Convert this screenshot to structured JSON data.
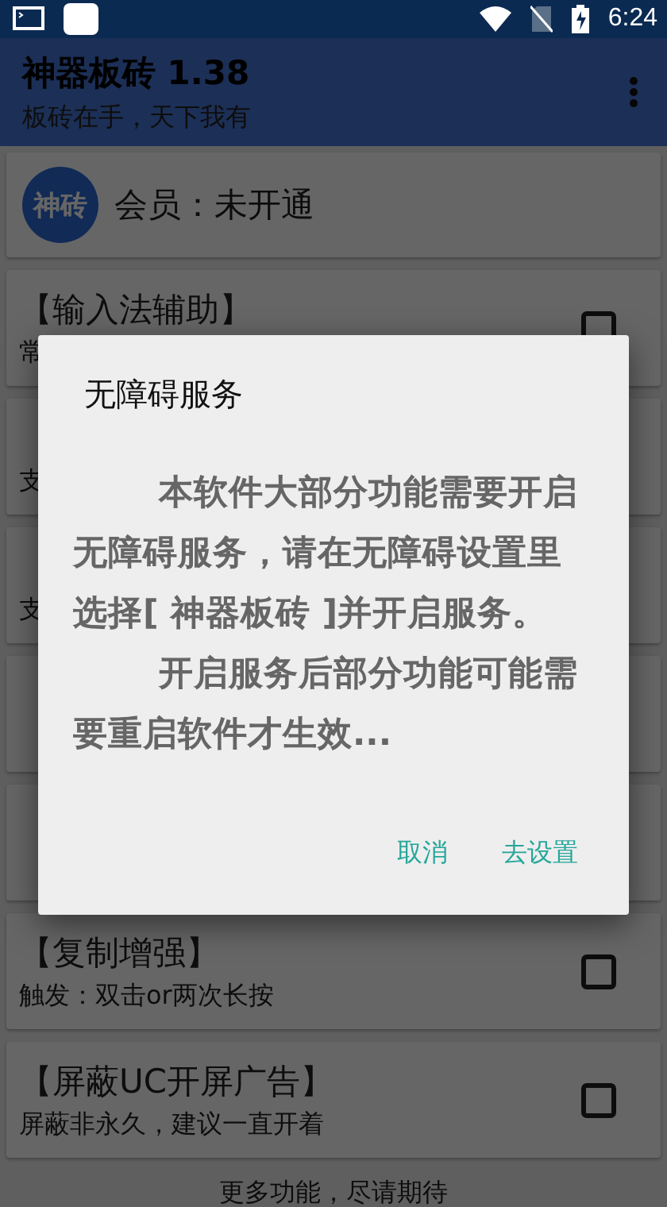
{
  "status_bar": {
    "time": "6:24"
  },
  "app_bar": {
    "title": "神器板砖  1.38",
    "subtitle": "板砖在手，天下我有"
  },
  "member": {
    "avatar_text": "神砖",
    "label": "会员：未开通"
  },
  "features": [
    {
      "kind": "feature",
      "title": "【输入法辅助】",
      "subtitle": "常",
      "checked": false
    },
    {
      "kind": "feature",
      "subtitle": "支"
    },
    {
      "kind": "feature",
      "subtitle": "支"
    },
    {
      "kind": "covered"
    },
    {
      "kind": "covered"
    },
    {
      "kind": "feature",
      "title": "【复制增强】",
      "subtitle": "触发：双击or两次长按",
      "checked": false
    },
    {
      "kind": "feature",
      "title": "【屏蔽UC开屏广告】",
      "subtitle": "屏蔽非永久，建议一直开着",
      "checked": false
    }
  ],
  "footer": "更多功能，尽请期待",
  "dialog": {
    "title": "无障碍服务",
    "paragraphs": [
      "本软件大部分功能需要开启无障碍服务，请在无障碍设置里选择[ 神器板砖 ]并开启服务。",
      "开启服务后部分功能可能需要重启软件才生效..."
    ],
    "buttons": [
      "取消",
      "去设置"
    ]
  }
}
